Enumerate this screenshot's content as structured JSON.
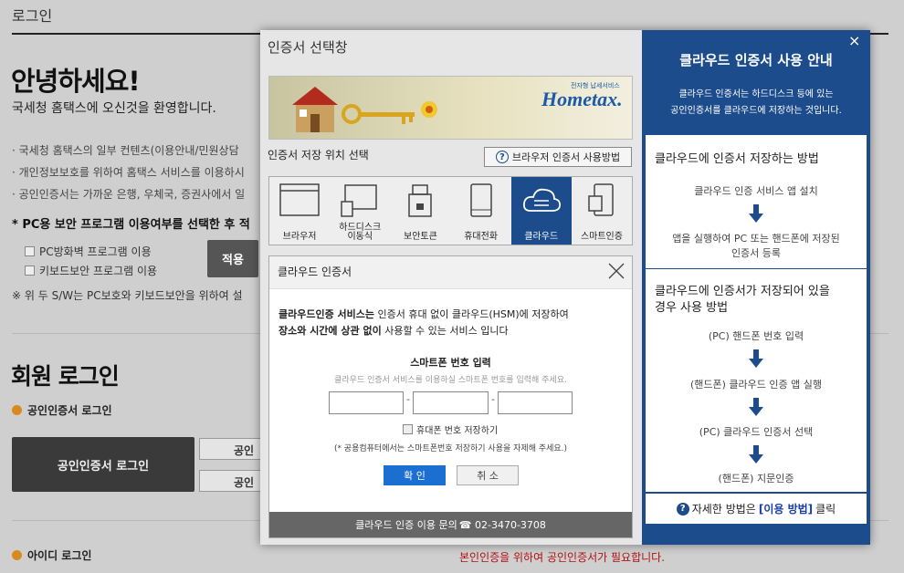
{
  "page": {
    "title": "로그인",
    "hello": "안녕하세요!",
    "welcome": "국세청 홈택스에 오신것을 환영합니다.",
    "bullets": [
      "국세청 홈택스의 일부 컨텐츠(이용안내/민원상담",
      "개인정보보호를 위하여 홈택스 서비스를 이용하시",
      "공인인증서는 가까운 은행, 우체국, 증권사에서 일"
    ],
    "pc_select": "* PC용 보안 프로그램 이용여부를 선택한 후 적",
    "firewall": "PC방화벽 프로그램 이용",
    "keyboard": "키보드보안 프로그램 이용",
    "apply": "적용",
    "note": "※ 위 두 S/W는 PC보호와 키보드보안을 위하여 설",
    "member_login": "회원 로그인",
    "cert_login_label": "공인인증서 로그인",
    "cert_login_button": "공인인증서 로그인",
    "small_btn_1": "공인",
    "small_btn_2": "공인",
    "id_login_label": "아이디 로그인",
    "red_notice": "본인인증을 위하여 공인인증서가 필요합니다."
  },
  "modal": {
    "title": "인증서 선택창",
    "banner_brand": "Hometax.",
    "banner_sub": "전자형 납세서비스",
    "storage_label": "인증서 저장 위치 선택",
    "howto_button": "브라우저 인증서 사용방법",
    "devices": [
      {
        "label": "브라우저",
        "icon": "browser-icon"
      },
      {
        "label": "하드디스크\n이동식",
        "icon": "hard-disk-icon"
      },
      {
        "label": "보안토큰",
        "icon": "security-token-icon"
      },
      {
        "label": "휴대전화",
        "icon": "mobile-phone-icon"
      },
      {
        "label": "클라우드",
        "icon": "cloud-icon"
      },
      {
        "label": "스마트인증",
        "icon": "smart-cert-icon"
      }
    ]
  },
  "cloud": {
    "title": "클라우드 인증서",
    "desc1_bold": "클라우드인증 서비스는",
    "desc1_rest": " 인증서 휴대 없이 클라우드(HSM)에 저장하여",
    "desc2_bold": "장소와 시간에 상관 없이",
    "desc2_rest": " 사용할 수 있는 서비스 입니다",
    "phone_label": "스마트폰 번호 입력",
    "phone_hint": "클라우드 인증서 서비스를 이용하실 스마트폰 번호를 입력해 주세요.",
    "phone_1": "",
    "phone_2": "",
    "phone_3": "",
    "dash": "-",
    "save_phone": "휴대폰 번호 저장하기",
    "public_note": "(* 공용컴퓨터에서는 스마트폰번호 저장하기 사용을 자제해 주세요.)",
    "ok": "확 인",
    "cancel": "취 소",
    "footer_text": "클라우드 인증 이용 문의 ",
    "footer_phone": "☎ 02-3470-3708"
  },
  "side": {
    "close": "×",
    "title": "클라우드 인증서 사용 안내",
    "sub1": "클라우드 인증서는 하드디스크 등에 있는",
    "sub2": "공인인증서를 클라우드에 저장하는 것입니다.",
    "how_store_title": "클라우드에 인증서 저장하는 방법",
    "store_step1": "클라우드 인증 서비스 앱 설치",
    "store_step2a": "앱을 실행하여 PC 또는 핸드폰에 저장된",
    "store_step2b": "인증서 등록",
    "use_title1": "클라우드에 인증서가 저장되어 있을",
    "use_title2": "경우 사용 방법",
    "use_step1": "(PC) 핸드폰 번호 입력",
    "use_step2": "(핸드폰) 클라우드 인증 앱 실행",
    "use_step3": "(PC) 클라우드 인증서 선택",
    "use_step4": "(핸드폰) 지문인증",
    "detail_pre": "자세한 방법은",
    "detail_link": "[이용 방법]",
    "detail_post": "클릭"
  }
}
